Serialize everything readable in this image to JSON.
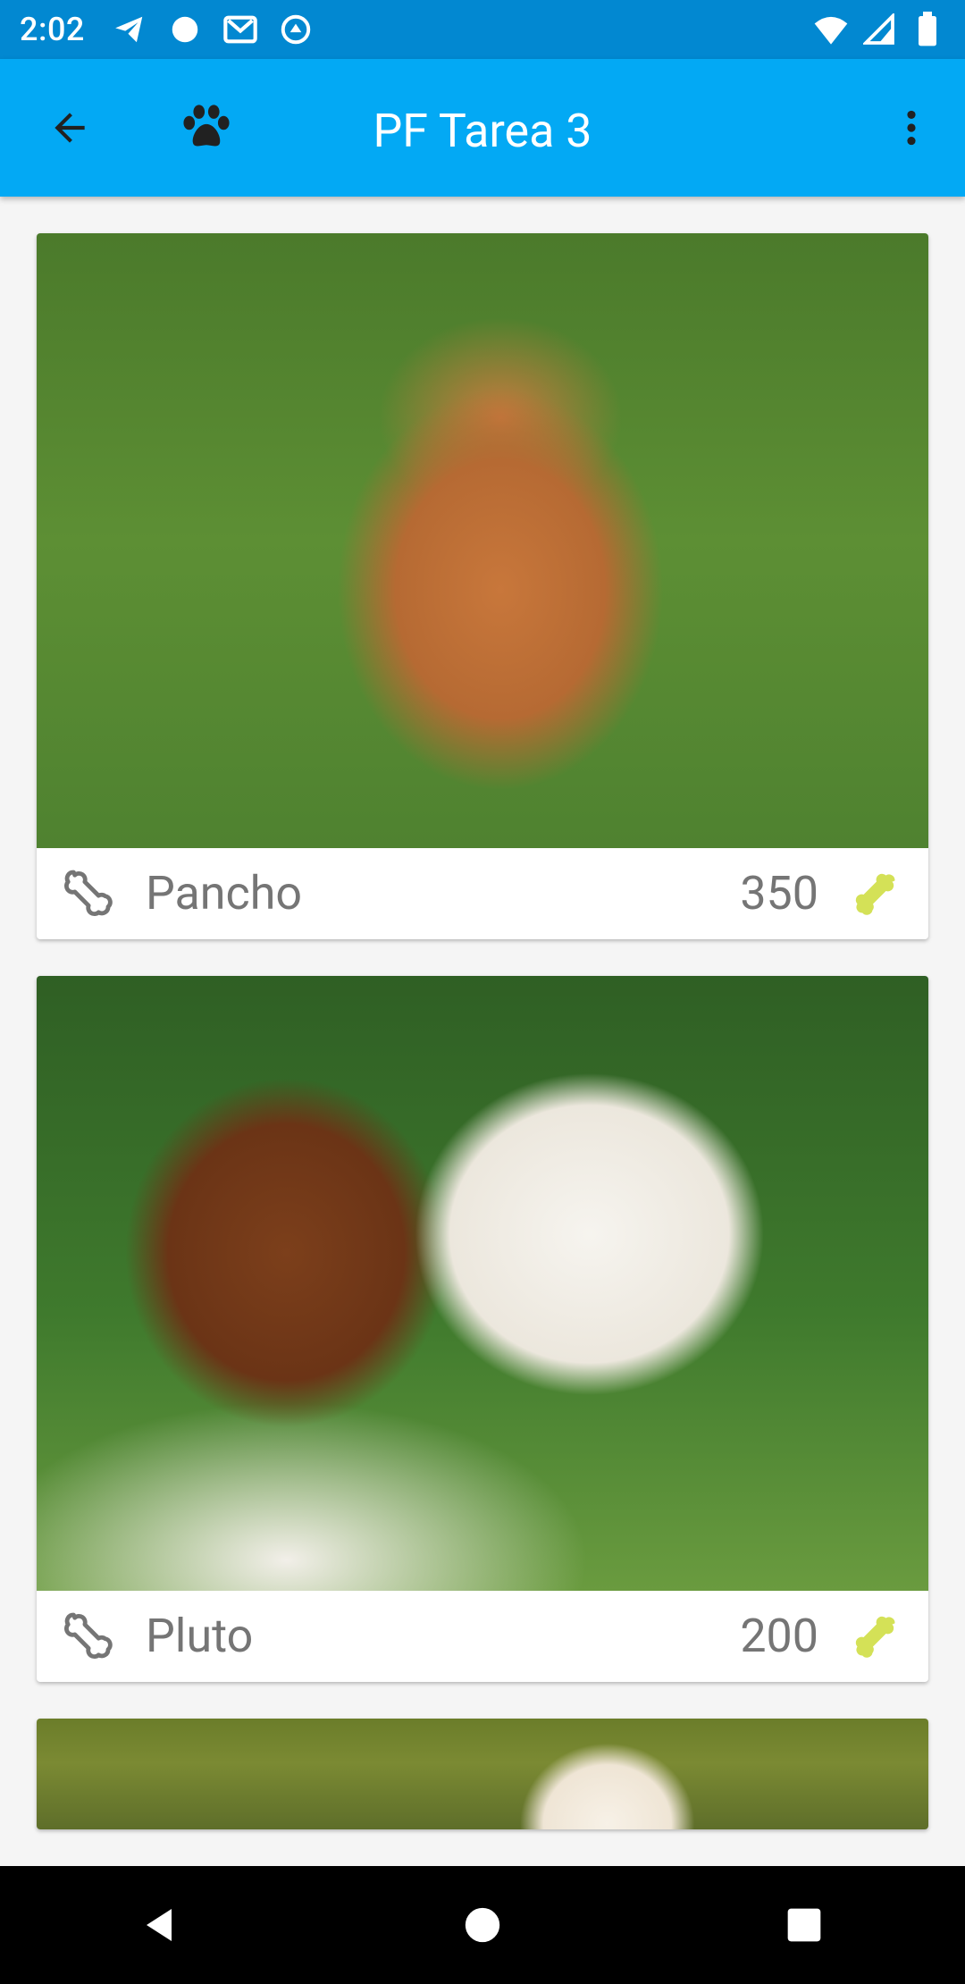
{
  "status_bar": {
    "time": "2:02",
    "left_icons": [
      "telegram-icon",
      "circle-icon",
      "gmail-icon",
      "vpn-icon"
    ],
    "right_icons": [
      "wifi-icon",
      "signal-icon",
      "battery-icon"
    ]
  },
  "app_bar": {
    "title": "PF Tarea 3",
    "back_icon": "arrow-back-icon",
    "paw_icon": "paw-icon",
    "overflow_icon": "more-vert-icon"
  },
  "cards": [
    {
      "name": "Pancho",
      "rating": "350",
      "photo": "pomeranian-on-grass"
    },
    {
      "name": "Pluto",
      "rating": "200",
      "photo": "saint-bernard"
    },
    {
      "name": "",
      "rating": "",
      "photo": "golden-puppy"
    }
  ],
  "colors": {
    "status_bar": "#0288d1",
    "app_bar": "#03a9f4",
    "text_secondary": "#757575",
    "bone_rated": "#d4e157"
  }
}
